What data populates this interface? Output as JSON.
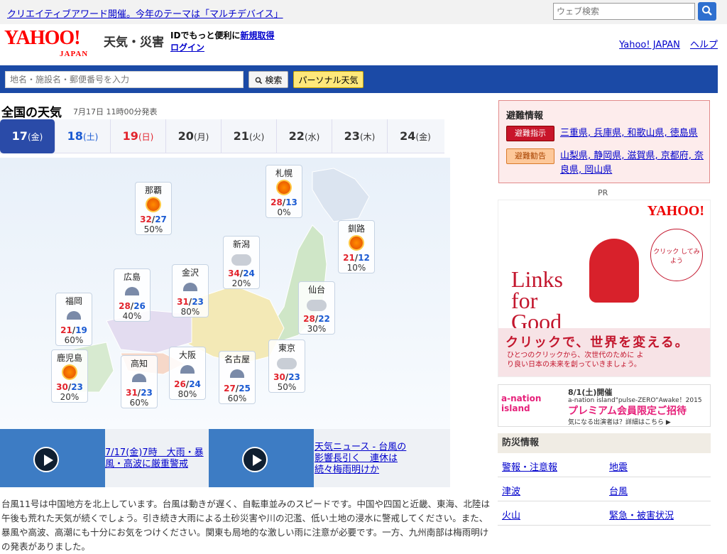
{
  "topbar": {
    "banner": "クリエイティブアワード開催。今年のテーマは「マルチデバイス」",
    "search_placeholder": "ウェブ検索"
  },
  "header": {
    "logo_main": "YAHOO!",
    "logo_sub": "JAPAN",
    "service_title": "天気・災害",
    "promo_prefix": "IDでもっと便利に",
    "promo_register": "新規取得",
    "promo_login": "ログイン",
    "link_yahoo": "Yahoo! JAPAN",
    "link_help": "ヘルプ"
  },
  "searchbar": {
    "placeholder": "地名・施設名・郵便番号を入力",
    "search_button": "検索",
    "personal_button": "パーソナル天気"
  },
  "main": {
    "title": "全国の天気",
    "issued": "7月17日 11時00分発表"
  },
  "days": [
    {
      "num": "17",
      "wd": "(金)"
    },
    {
      "num": "18",
      "wd": "(土)"
    },
    {
      "num": "19",
      "wd": "(日)"
    },
    {
      "num": "20",
      "wd": "(月)"
    },
    {
      "num": "21",
      "wd": "(火)"
    },
    {
      "num": "22",
      "wd": "(水)"
    },
    {
      "num": "23",
      "wd": "(木)"
    },
    {
      "num": "24",
      "wd": "(金)"
    }
  ],
  "cities": [
    {
      "name": "那覇",
      "icon": "sun-rain-icon",
      "hi": "32",
      "lo": "27",
      "pop": "50%"
    },
    {
      "name": "札幌",
      "icon": "sun-to-rain-icon",
      "hi": "28",
      "lo": "13",
      "pop": "0%"
    },
    {
      "name": "釧路",
      "icon": "sun-icon",
      "hi": "21",
      "lo": "12",
      "pop": "10%"
    },
    {
      "name": "新潟",
      "icon": "cloud-icon",
      "hi": "34",
      "lo": "24",
      "pop": "20%"
    },
    {
      "name": "広島",
      "icon": "rain-to-cloud-icon",
      "hi": "28",
      "lo": "26",
      "pop": "40%"
    },
    {
      "name": "金沢",
      "icon": "rain-cloud-icon",
      "hi": "31",
      "lo": "23",
      "pop": "80%"
    },
    {
      "name": "仙台",
      "icon": "cloud-icon",
      "hi": "28",
      "lo": "22",
      "pop": "30%"
    },
    {
      "name": "福岡",
      "icon": "rain-icon",
      "hi": "21",
      "lo": "19",
      "pop": "60%"
    },
    {
      "name": "鹿児島",
      "icon": "sun-icon",
      "hi": "30",
      "lo": "23",
      "pop": "20%"
    },
    {
      "name": "高知",
      "icon": "rain-to-cloud-icon",
      "hi": "31",
      "lo": "23",
      "pop": "60%"
    },
    {
      "name": "大阪",
      "icon": "rain-icon",
      "hi": "26",
      "lo": "24",
      "pop": "80%"
    },
    {
      "name": "名古屋",
      "icon": "rain-cloud-icon",
      "hi": "27",
      "lo": "25",
      "pop": "60%"
    },
    {
      "name": "東京",
      "icon": "cloud-to-rain-icon",
      "hi": "30",
      "lo": "23",
      "pop": "50%"
    }
  ],
  "videos": [
    {
      "caption": "7/17(金)7時　大雨・暴風・高波に厳重警戒"
    },
    {
      "caption": "天気ニュース - 台風の影響長引く　連休は続々梅雨明けか"
    }
  ],
  "summary": "台風11号は中国地方を北上しています。台風は動きが遅く、自転車並みのスピードです。中国や四国と近畿、東海、北陸は午後も荒れた天気が続くでしょう。引き続き大雨による土砂災害や川の氾濫、低い土地の浸水に警戒してください。また、暴風や高波、高潮にも十分にお気をつけください。関東も局地的な激しい雨に注意が必要です。一方、九州南部は梅雨明けの発表がありました。",
  "evacuation": {
    "title": "避難情報",
    "shiji_label": "避難指示",
    "shiji_areas": "三重県, 兵庫県, 和歌山県, 徳島県",
    "kankoku_label": "避難勧告",
    "kankoku_areas_1": "山梨県, 静岡県, 滋賀県, 京都府, 奈",
    "kankoku_areas_2": "良県, 岡山県"
  },
  "ads": {
    "pr": "PR",
    "main_logo": "YAHOO!",
    "main_headline": "Links for Good",
    "main_click": "クリックで、世界を変える。",
    "main_sub": "ひとつのクリックから、次世代のために より良い日本の未来を創っていきましょう。",
    "main_balloon": "クリック してみよう",
    "anation_logo": "a-nation island",
    "anation_date": "8/1(土)開催",
    "anation_event": "a-nation island\"pulse-ZERO\"Awake！2015",
    "anation_headline": "プレミアム会員限定ご招待",
    "anation_note": "気になる出演者は？詳細はこちら ▶"
  },
  "disaster": {
    "title": "防災情報",
    "items": [
      [
        "警報・注意報",
        "地震"
      ],
      [
        "津波",
        "台風"
      ],
      [
        "火山",
        "緊急・被害状況"
      ]
    ]
  },
  "colors": {
    "accent_blue": "#1b4aa6",
    "hi_red": "#e2242d",
    "lo_blue": "#1a5ad2",
    "alert_red": "#c8152a"
  }
}
